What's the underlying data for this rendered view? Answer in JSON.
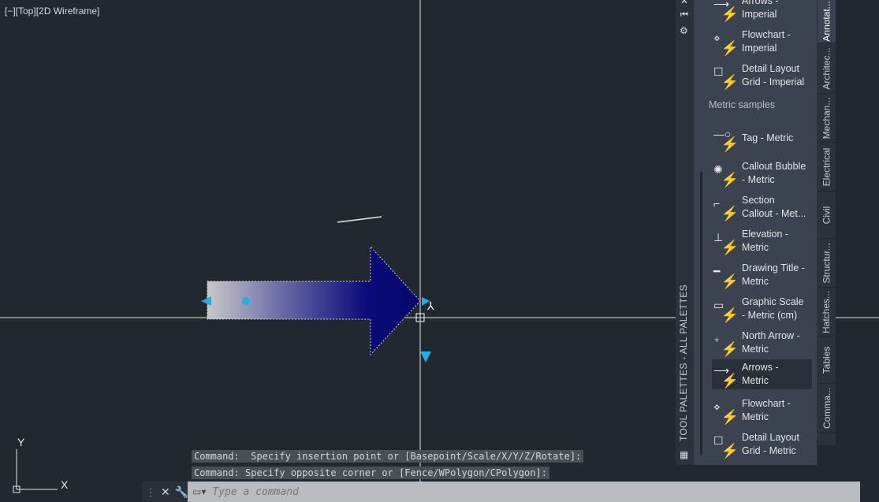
{
  "viewport": {
    "label": "[−][Top][2D Wireframe]",
    "ucs": {
      "x": "X",
      "y": "Y"
    },
    "hatch_colors": [
      "#c8c8c8",
      "#0a0a7a"
    ],
    "grip_color": "#1fb0e6"
  },
  "command": {
    "history": [
      "Command:  Specify insertion point or [Basepoint/Scale/X/Y/Z/Rotate]:",
      "Command: Specify opposite corner or [Fence/WPolygon/CPolygon]:"
    ],
    "placeholder": "Type a command"
  },
  "palette": {
    "title": "TOOL PALETTES - ALL PALETTES",
    "section": "Metric samples",
    "items_top": [
      {
        "label1": "Arrows -",
        "label2": "Imperial",
        "icon": "arrow-icon"
      },
      {
        "label1": "Flowchart -",
        "label2": "Imperial",
        "icon": "flowchart-icon"
      },
      {
        "label1": "Detail Layout",
        "label2": "Grid - Imperial",
        "icon": "grid-icon"
      }
    ],
    "items": [
      {
        "label1": "Tag - Metric",
        "label2": "",
        "icon": "tag-icon"
      },
      {
        "label1": "Callout Bubble",
        "label2": "- Metric",
        "icon": "callout-icon"
      },
      {
        "label1": "Section",
        "label2": "Callout - Met...",
        "icon": "section-icon"
      },
      {
        "label1": "Elevation -",
        "label2": "Metric",
        "icon": "elevation-icon"
      },
      {
        "label1": "Drawing Title -",
        "label2": "Metric",
        "icon": "title-icon"
      },
      {
        "label1": "Graphic Scale",
        "label2": "- Metric (cm)",
        "icon": "scale-icon"
      },
      {
        "label1": "North Arrow  -",
        "label2": "Metric",
        "icon": "north-arrow-icon"
      },
      {
        "label1": "Arrows -",
        "label2": "Metric",
        "icon": "arrow-icon",
        "selected": true
      },
      {
        "label1": "Flowchart -",
        "label2": "Metric",
        "icon": "flowchart-icon"
      },
      {
        "label1": "Detail Layout",
        "label2": "Grid  - Metric",
        "icon": "grid-icon"
      }
    ],
    "tabs": [
      "Annotat...",
      "Architec...",
      "Mechan...",
      "Electrical",
      "Civil",
      "Structur...",
      "Hatches...",
      "Tables",
      "Comma..."
    ],
    "active_tab": "Annotat..."
  }
}
